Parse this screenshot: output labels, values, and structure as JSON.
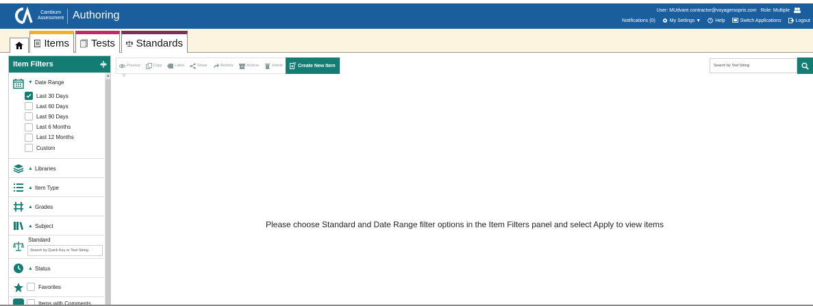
{
  "header": {
    "logo_text_line1": "Cambium",
    "logo_text_line2": "Assessment",
    "app_title": "Authoring",
    "user_text": "User: MUdvare.contractor@voyagersopris.com",
    "role_text": "Role: Multiple",
    "notifications": "Notifications (0)",
    "my_settings": "My Settings ▼",
    "help": "Help",
    "switch_apps": "Switch Applications",
    "logout": "Logout"
  },
  "tabs": {
    "items": "Items",
    "tests": "Tests",
    "standards": "Standards"
  },
  "filters": {
    "title": "Item Filters",
    "date_range": {
      "label": "Date Range",
      "options": [
        {
          "label": "Last 30 Days",
          "checked": true
        },
        {
          "label": "Last 60 Days",
          "checked": false
        },
        {
          "label": "Last 90 Days",
          "checked": false
        },
        {
          "label": "Last 6 Months",
          "checked": false
        },
        {
          "label": "Last 12 Months",
          "checked": false
        },
        {
          "label": "Custom",
          "checked": false
        }
      ]
    },
    "libraries": "Libraries",
    "item_type": "Item Type",
    "grades": "Grades",
    "subject": "Subject",
    "standard": {
      "label": "Standard",
      "placeholder": "Search by Quick Key or Text String"
    },
    "status": "Status",
    "favorites": "Favorites",
    "comments": "Items with Comments"
  },
  "toolbar": {
    "preview": "Preview",
    "copy": "Copy",
    "label": "Label",
    "share": "Share",
    "restore": "Restore",
    "archive": "Archive",
    "delete": "Delete",
    "create": "Create New Item"
  },
  "search": {
    "placeholder": "Search by Text String"
  },
  "main": {
    "message": "Please choose Standard and Date Range filter options in the Item Filters panel and select Apply to view items"
  },
  "colors": {
    "header_blue": "#1a5e9e",
    "teal": "#137d73",
    "items_tab": "#f2b230",
    "tests_tab": "#c0296d",
    "standards_tab": "#7d2e5c",
    "tab_band": "#fdf4e0"
  }
}
